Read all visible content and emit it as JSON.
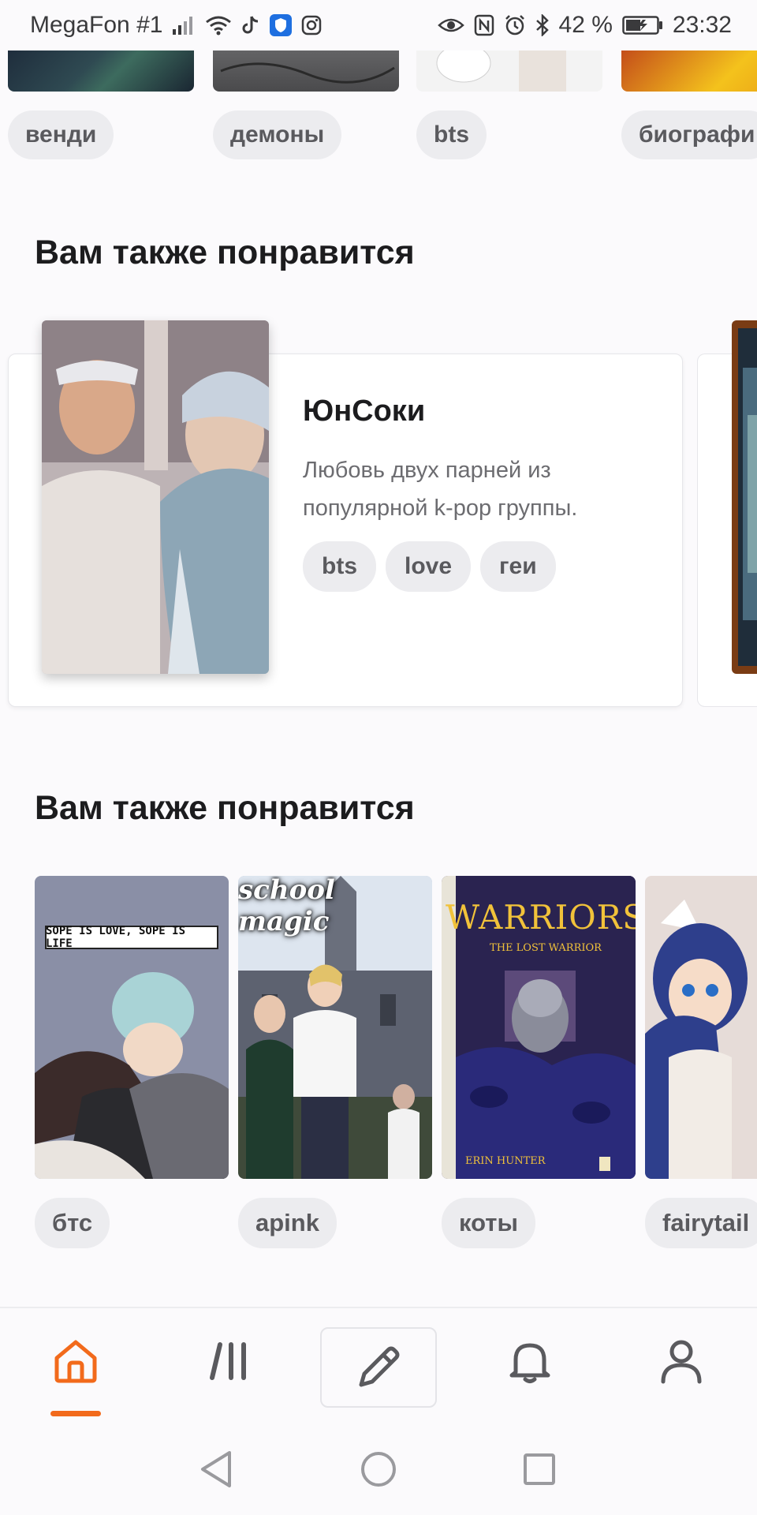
{
  "status_bar": {
    "carrier": "MegaFon #1",
    "battery": "42 %",
    "time": "23:32",
    "icons": [
      "signal-icon",
      "wifi-icon",
      "tiktok-icon",
      "shield-app-icon",
      "instagram-icon",
      "eye-icon",
      "nfc-icon",
      "alarm-icon",
      "bluetooth-icon",
      "battery-icon"
    ]
  },
  "top_row": {
    "tags": [
      "венди",
      "демоны",
      "bts",
      "биографи"
    ]
  },
  "featured": {
    "heading": "Вам также понравится",
    "title": "ЮнСоки",
    "description": "Любовь двух парней из популярной k-pop группы.",
    "tags": [
      "bts",
      "love",
      "геи"
    ]
  },
  "recommendations": {
    "heading": "Вам также понравится",
    "books": [
      {
        "cover_text": "SOPE IS LOVE, SOPE IS LIFE",
        "tag": "бтс"
      },
      {
        "cover_text": "school magic",
        "tag": "apink"
      },
      {
        "cover_text": "WARRIORS",
        "cover_sub": "THE LOST WARRIOR",
        "cover_author": "ERIN HUNTER",
        "tag": "коты"
      },
      {
        "cover_text": "",
        "tag": "fairytail"
      }
    ]
  },
  "bottom_nav": {
    "items": [
      "home-icon",
      "library-icon",
      "write-icon",
      "notifications-icon",
      "profile-icon"
    ],
    "active": "home-icon",
    "accent": "#f26a1b"
  },
  "system_nav": [
    "back-icon",
    "home-circle-icon",
    "recents-icon"
  ]
}
